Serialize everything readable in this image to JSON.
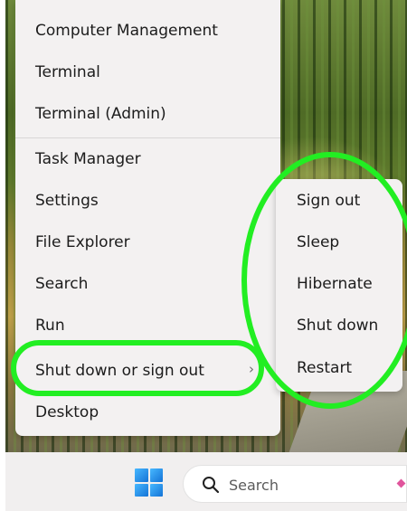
{
  "menu": {
    "items": [
      {
        "label": "Computer Management"
      },
      {
        "label": "Terminal"
      },
      {
        "label": "Terminal (Admin)"
      },
      {
        "label": "Task Manager"
      },
      {
        "label": "Settings"
      },
      {
        "label": "File Explorer"
      },
      {
        "label": "Search"
      },
      {
        "label": "Run"
      },
      {
        "label": "Shut down or sign out"
      },
      {
        "label": "Desktop"
      }
    ],
    "submenu_indicator": "›"
  },
  "submenu": {
    "items": [
      {
        "label": "Sign out"
      },
      {
        "label": "Sleep"
      },
      {
        "label": "Hibernate"
      },
      {
        "label": "Shut down"
      },
      {
        "label": "Restart"
      }
    ]
  },
  "taskbar": {
    "search_label": "Search",
    "start_icon": "windows-logo-icon",
    "search_icon": "magnifier-icon"
  },
  "colors": {
    "annotation": "#22ee22",
    "menu_bg": "#f3f1f1",
    "windows_blue": "#1a8cf0"
  }
}
